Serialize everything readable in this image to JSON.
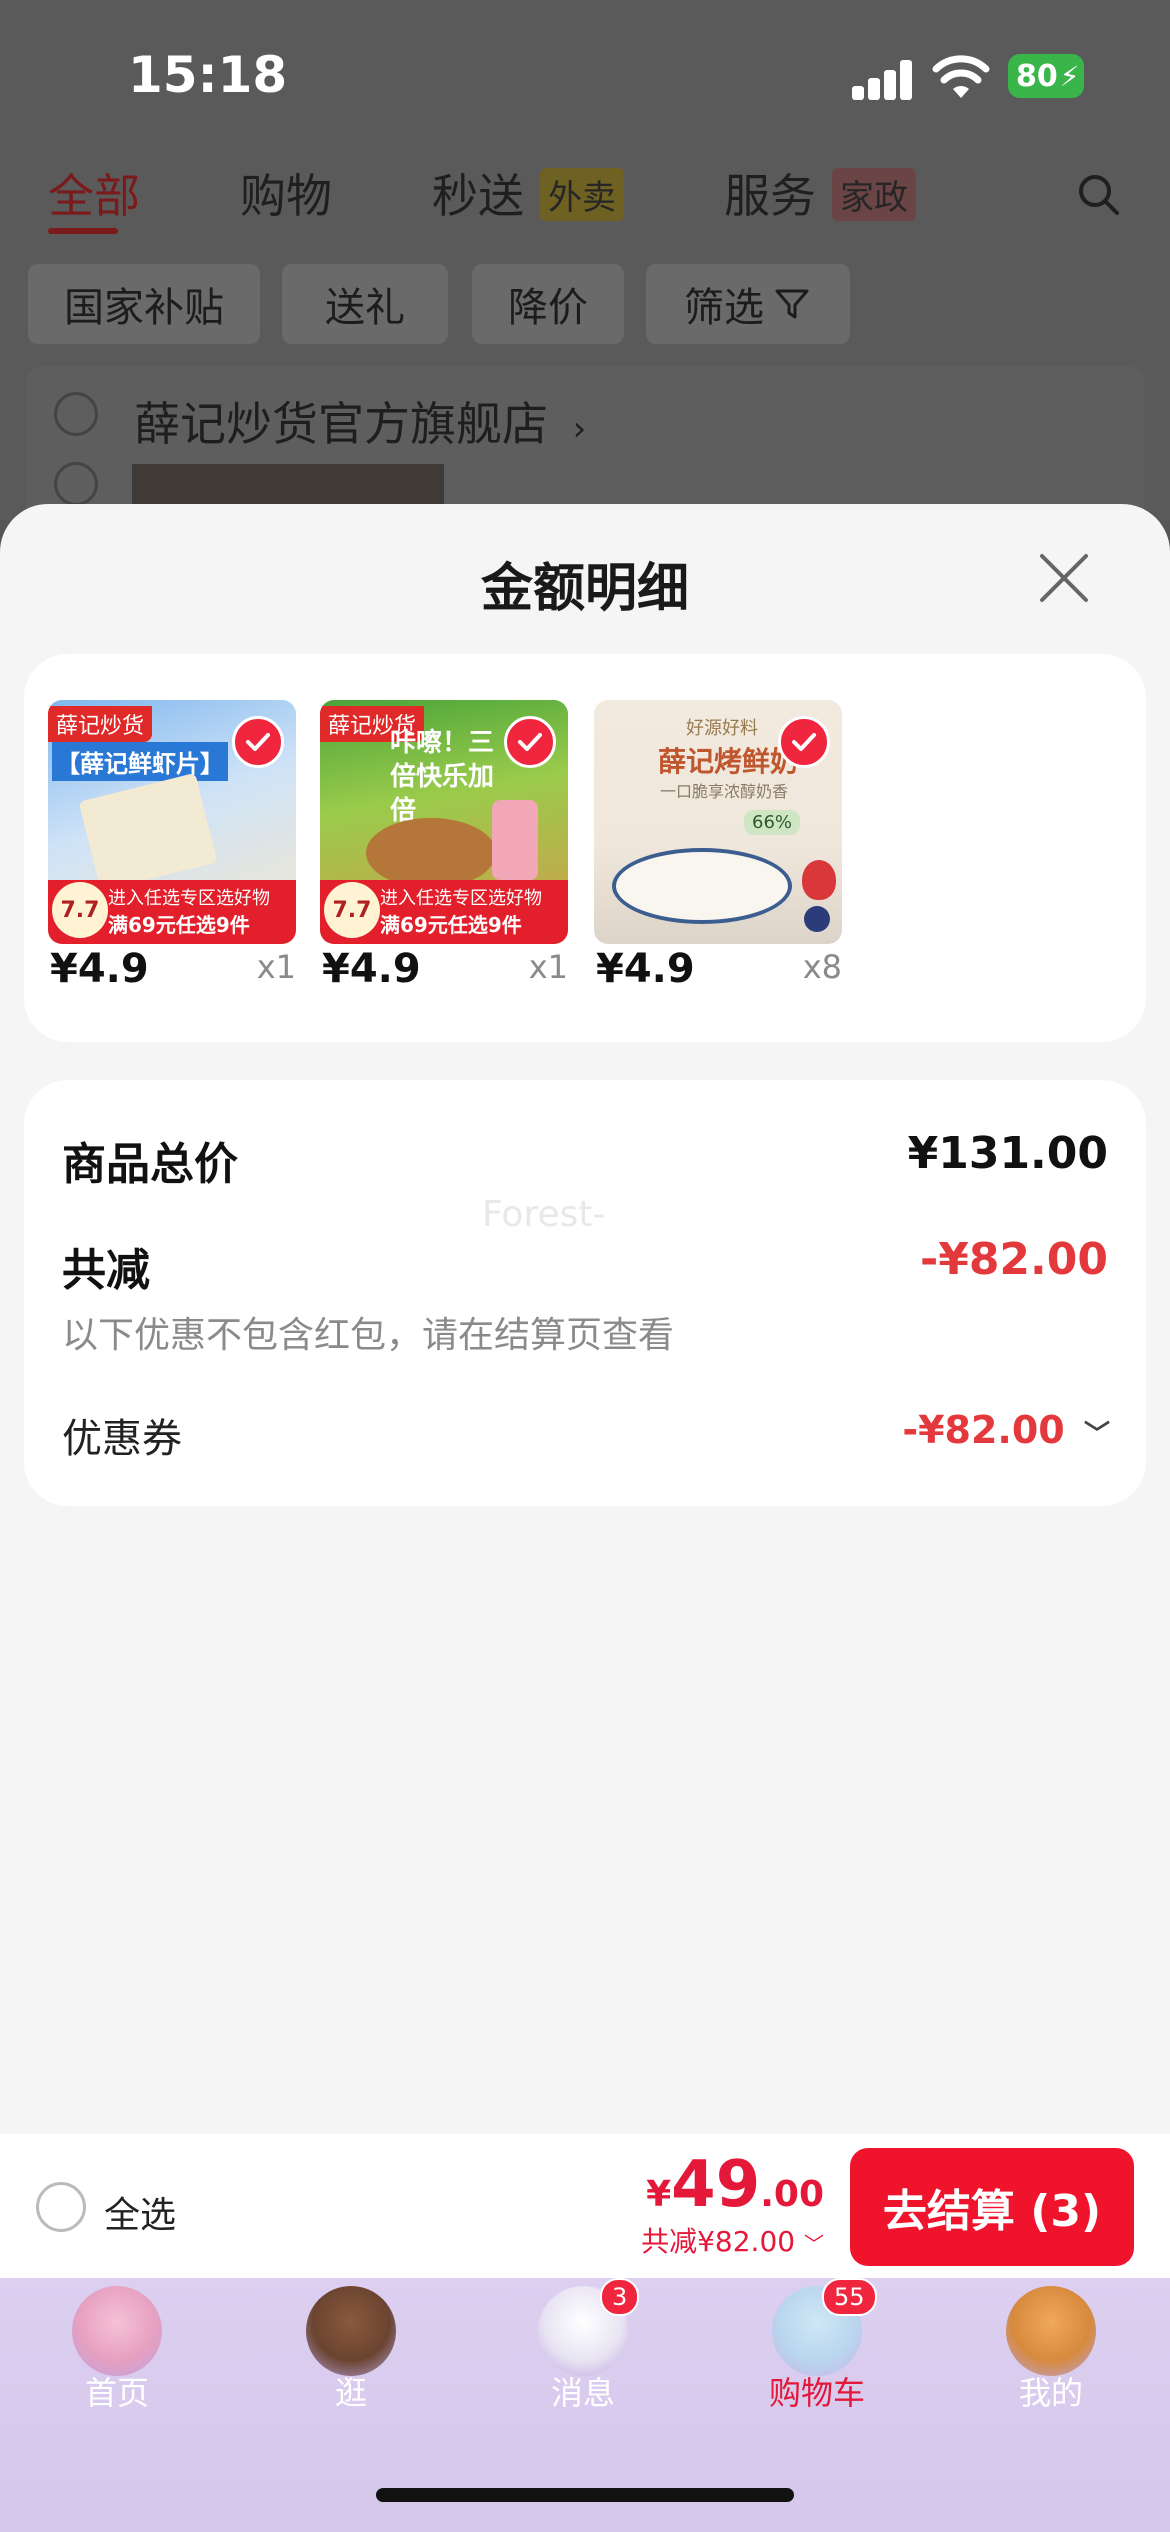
{
  "status_bar": {
    "time": "15:18",
    "battery": "80"
  },
  "top_tabs": [
    {
      "label": "全部",
      "active": true
    },
    {
      "label": "购物"
    },
    {
      "label": "秒送",
      "badge": "外卖"
    },
    {
      "label": "服务",
      "badge": "家政"
    }
  ],
  "filter_chips": [
    "国家补贴",
    "送礼",
    "降价",
    "筛选"
  ],
  "store": {
    "name": "薛记炒货官方旗舰店"
  },
  "sheet": {
    "title": "金额明细",
    "products": [
      {
        "price": "¥4.9",
        "qty": "x1",
        "tag": "薛记炒货",
        "headline": "【薛记鲜虾片】",
        "strip_top": "进入任选专区选好物",
        "strip_bottom": "满69元任选9件",
        "badge": "7.7"
      },
      {
        "price": "¥4.9",
        "qty": "x1",
        "tag": "薛记炒货",
        "headline": "咔嚓！三倍快乐加倍",
        "strip_top": "进入任选专区选好物",
        "strip_bottom": "满69元任选9件",
        "badge": "7.7"
      },
      {
        "price": "¥4.9",
        "qty": "x8",
        "tag": "好源好料",
        "headline": "薛记烤鲜奶",
        "subline": "一口脆享浓醇奶香",
        "pill": "66%"
      }
    ],
    "summary": {
      "total_label": "商品总价",
      "total_value": "¥131.00",
      "discount_label": "共减",
      "discount_value": "-¥82.00",
      "note": "以下优惠不包含红包，请在结算页查看",
      "coupon_label": "优惠券",
      "coupon_value": "-¥82.00",
      "watermark": "Forest-"
    }
  },
  "checkout": {
    "select_all": "全选",
    "currency": "¥",
    "amount_int": "49",
    "amount_dec": ".00",
    "saved": "共减¥82.00",
    "button": "去结算 (3)"
  },
  "tabbar": [
    {
      "label": "首页"
    },
    {
      "label": "逛"
    },
    {
      "label": "消息",
      "badge": "3"
    },
    {
      "label": "购物车",
      "badge": "55",
      "active": true
    },
    {
      "label": "我的"
    }
  ],
  "colors": {
    "accent_red": "#e4193a",
    "sheet_bg": "#f5f5f5",
    "tabbar_bg": "#d8cbee"
  }
}
